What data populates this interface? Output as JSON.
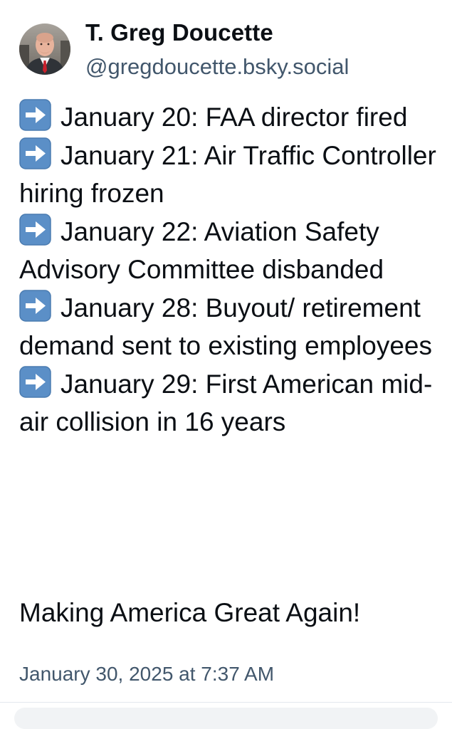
{
  "author": {
    "display_name": "T. Greg Doucette",
    "handle": "@gregdoucette.bsky.social",
    "avatar_icon": "profile-photo"
  },
  "post": {
    "items": [
      {
        "icon": "right-arrow-emoji",
        "text": "January 20: FAA director fired"
      },
      {
        "icon": "right-arrow-emoji",
        "text": "January 21: Air Traffic Controller hiring frozen"
      },
      {
        "icon": "right-arrow-emoji",
        "text": "January 22: Aviation Safety Advisory Committee disbanded"
      },
      {
        "icon": "right-arrow-emoji",
        "text": "January 28: Buyout/ retirement demand sent to existing employees"
      },
      {
        "icon": "right-arrow-emoji",
        "text": "January 29: First American mid-air collision in 16 years"
      }
    ],
    "closing": "Making America Great Again!",
    "timestamp": "January 30, 2025 at 7:37 AM"
  },
  "colors": {
    "text": "#0b0f14",
    "secondary_text": "#42576c",
    "arrow_emoji_bg": "#5b8fc7",
    "divider": "#e3e8ee"
  }
}
